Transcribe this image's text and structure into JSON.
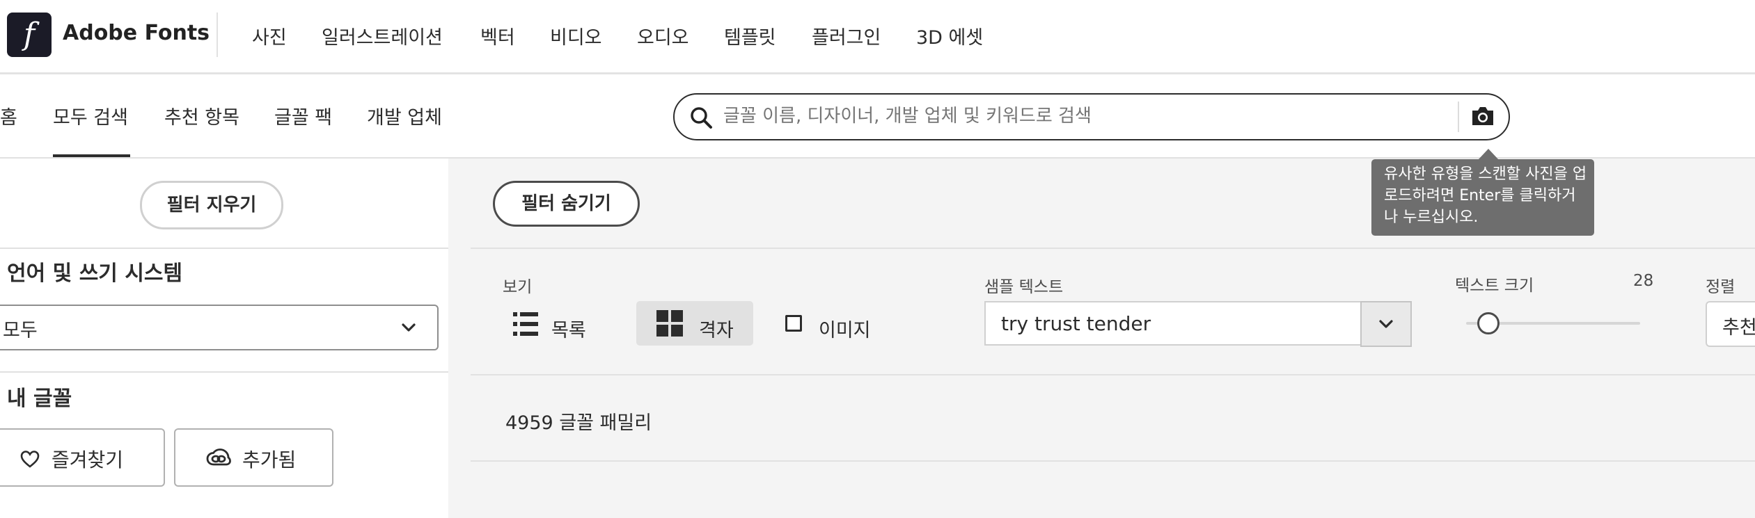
{
  "app": {
    "brand": "Adobe Fonts",
    "logo_letter": "f"
  },
  "top_nav": {
    "items": [
      "사진",
      "일러스트레이션",
      "벡터",
      "비디오",
      "오디오",
      "템플릿",
      "플러그인",
      "3D 에셋"
    ]
  },
  "sub_nav": {
    "items": [
      "홈",
      "모두 검색",
      "추천 항목",
      "글꼴 팩",
      "개발 업체"
    ],
    "active": "모두 검색"
  },
  "search": {
    "placeholder": "글꼴 이름, 디자이너, 개발 업체 및 키워드로 검색",
    "search_icon": "search-icon",
    "camera_icon": "camera-icon"
  },
  "tooltip": {
    "text": "유사한 유형을 스캔할 사진을 업로드하려면 Enter를 클릭하거나 누르십시오."
  },
  "filters": {
    "clear_label": "필터 지우기",
    "language_title": "언어 및 쓰기 시스템",
    "language_value": "모두",
    "my_fonts_title": "내 글꼴",
    "favorites_label": "즐겨찾기",
    "added_label": "추가됨"
  },
  "toolbar": {
    "hide_filters_label": "필터 숨기기",
    "view_label": "보기",
    "view_options": {
      "list": "목록",
      "grid": "격자",
      "image": "이미지"
    },
    "selected_view": "격자",
    "sample_text_label": "샘플 텍스트",
    "sample_text_value": "try trust tender",
    "text_size_label": "텍스트 크기",
    "text_size_value": "28",
    "sort_label": "정렬",
    "sort_value_partial": "추천"
  },
  "results": {
    "count_text": "4959 글꼴 패밀리"
  },
  "colors": {
    "logo_bg": "#1b1b27",
    "main_bg": "#f4f4f4",
    "tooltip_bg": "#6e6e6e",
    "text": "#2c2c2c",
    "selected_view_bg": "#e1e1e1"
  }
}
